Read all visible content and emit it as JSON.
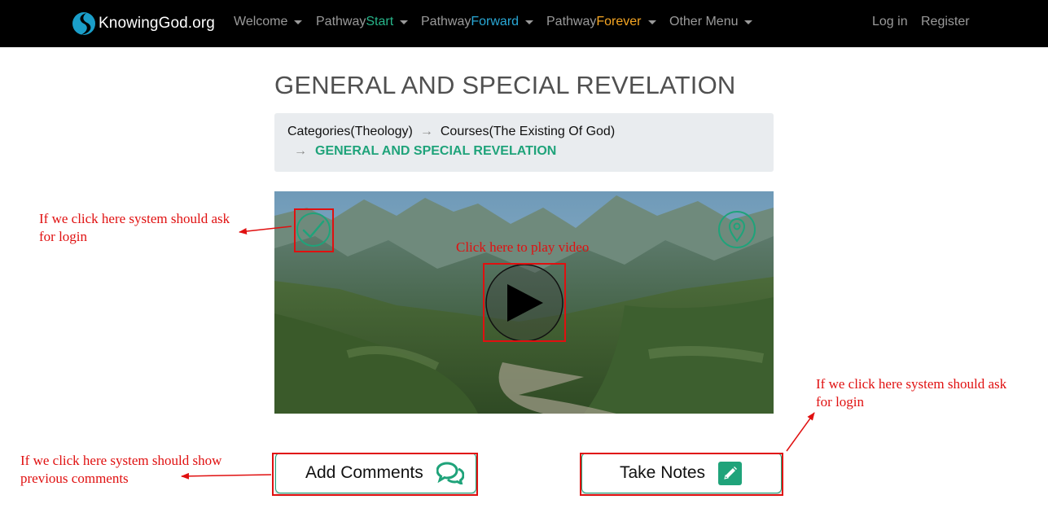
{
  "navbar": {
    "brand": "KnowingGod.org",
    "menus": [
      {
        "prefix": "Welcome",
        "accent": ""
      },
      {
        "prefix": "Pathway",
        "accent": "Start"
      },
      {
        "prefix": "Pathway",
        "accent": "Forward"
      },
      {
        "prefix": "Pathway",
        "accent": "Forever"
      },
      {
        "prefix": "Other Menu",
        "accent": ""
      }
    ],
    "login": "Log in",
    "register": "Register"
  },
  "page": {
    "title": "GENERAL AND SPECIAL REVELATION"
  },
  "breadcrumb": {
    "arrow": "→",
    "category": "Categories(Theology)",
    "course": "Courses(The Existing Of God)",
    "current": "GENERAL AND SPECIAL REVELATION"
  },
  "actions": {
    "add_comments": "Add Comments",
    "take_notes": "Take Notes"
  },
  "annotations": {
    "check_note": [
      "If we click here system should ask",
      "for login"
    ],
    "play_note": "Click here to play video",
    "notes_note": [
      "If we click here system should ask",
      "for login"
    ],
    "comments_note": [
      "If we click here system should show",
      "previous comments"
    ]
  },
  "icons": {
    "brand": "knowinggod-logo-icon",
    "check": "check-circle-icon",
    "pin": "map-pin-icon",
    "play": "play-icon",
    "comments": "comments-icon",
    "notes": "pencil-square-icon"
  },
  "colors": {
    "accent": "#1fa37a",
    "start": "#27b58a",
    "forward": "#29a8d6",
    "forever": "#f6a623",
    "annotation": "#e01010",
    "navbar": "#000000"
  }
}
